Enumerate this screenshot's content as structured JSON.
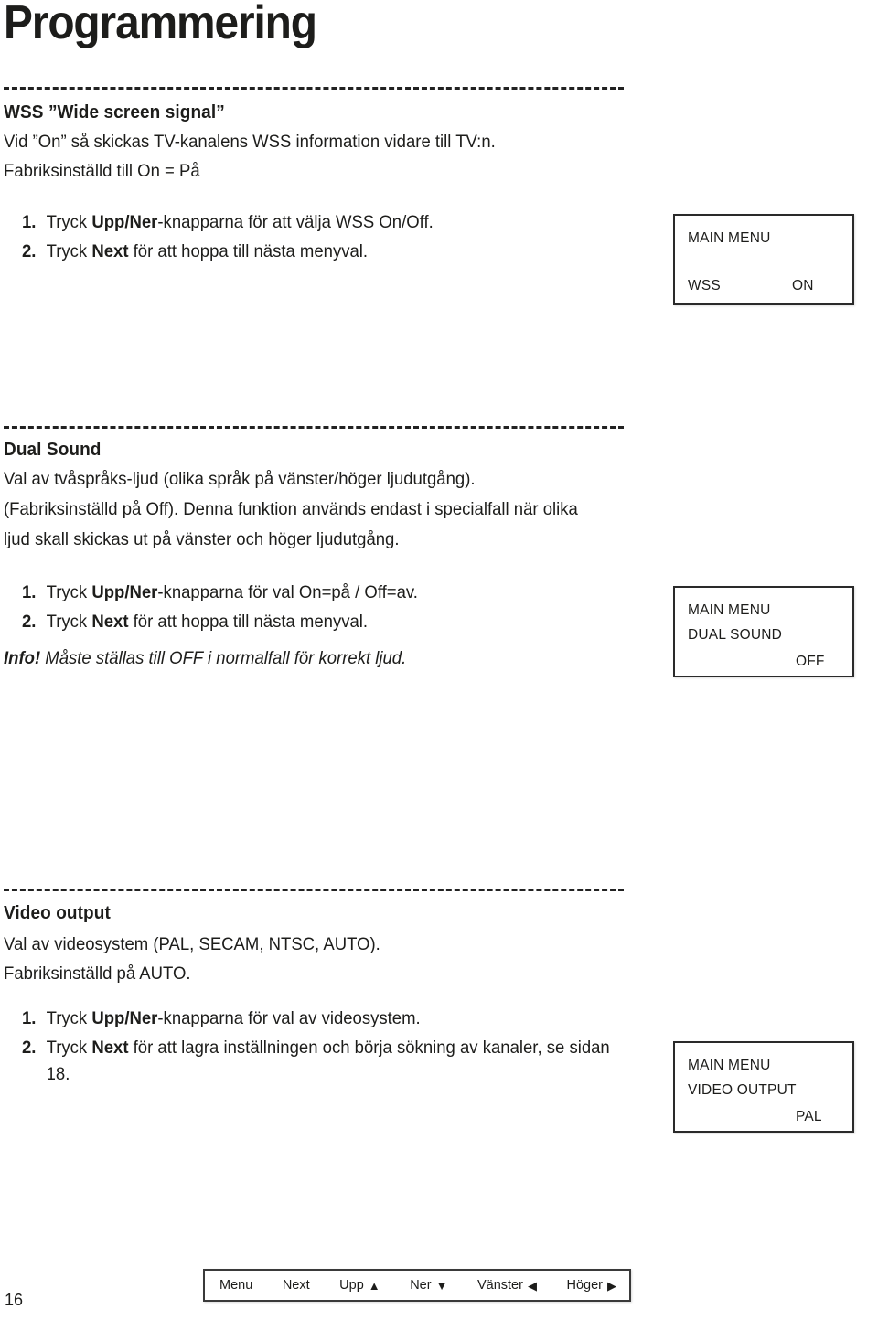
{
  "page": {
    "title": "Programmering",
    "number": "16"
  },
  "sections": [
    {
      "id": "wss",
      "heading": "WSS ”Wide screen signal”",
      "paragraphs": [
        "Vid ”On” så skickas TV-kanalens WSS information vidare till TV:n.",
        "Fabriksinställd till On = På"
      ],
      "steps": [
        {
          "num": "1.",
          "pre": "Tryck ",
          "bold": "Upp/Ner",
          "post": "-knapparna för att välja WSS On/Off."
        },
        {
          "num": "2.",
          "pre": "Tryck ",
          "bold": "Next",
          "post": " för att hoppa till nästa menyval."
        }
      ],
      "menu_box": {
        "title": "MAIN MENU",
        "item": "WSS",
        "value": "ON"
      }
    },
    {
      "id": "dual_sound",
      "heading": "Dual Sound",
      "paragraphs": [
        "Val av tvåspråks-ljud (olika språk på vänster/höger ljudutgång).",
        "(Fabriksinställd på Off). Denna funktion används endast i specialfall när olika",
        "ljud skall skickas ut på vänster och höger ljudutgång."
      ],
      "steps": [
        {
          "num": "1.",
          "pre": "Tryck ",
          "bold": "Upp/Ner",
          "post": "-knapparna för val On=på / Off=av."
        },
        {
          "num": "2.",
          "pre": "Tryck ",
          "bold": "Next",
          "post": " för att hoppa till nästa menyval."
        }
      ],
      "info": {
        "label": "Info!",
        "text": " Måste ställas till OFF i normalfall för korrekt ljud."
      },
      "menu_box": {
        "title": "MAIN MENU",
        "item": "DUAL SOUND",
        "value": "OFF"
      }
    },
    {
      "id": "video_output",
      "heading": "Video output",
      "paragraphs": [
        "Val av videosystem (PAL, SECAM, NTSC, AUTO).",
        "Fabriksinställd på AUTO."
      ],
      "steps": [
        {
          "num": "1.",
          "pre": "Tryck ",
          "bold": "Upp/Ner",
          "post": "-knapparna för val av videosystem."
        },
        {
          "num": "2.",
          "pre": "Tryck ",
          "bold": "Next",
          "post": " för att lagra inställningen och börja sökning av kanaler, se sidan 18."
        }
      ],
      "menu_box": {
        "title": "MAIN MENU",
        "item": "VIDEO OUTPUT",
        "value": "PAL"
      }
    }
  ],
  "nav_legend": {
    "items": [
      {
        "label": "Menu",
        "arrow": "",
        "arrow_icon": "none"
      },
      {
        "label": "Next",
        "arrow": "",
        "arrow_icon": "none"
      },
      {
        "label": "Upp",
        "arrow": "▲",
        "arrow_icon": "triangle-up-icon"
      },
      {
        "label": "Ner",
        "arrow": "▼",
        "arrow_icon": "triangle-down-icon"
      },
      {
        "label": "Vänster",
        "arrow": "◀",
        "arrow_icon": "triangle-left-icon"
      },
      {
        "label": "Höger",
        "arrow": "▶",
        "arrow_icon": "triangle-right-icon"
      }
    ]
  },
  "colors": {
    "text": "#1d1d1b",
    "rule": "#222222",
    "box_border": "#2a2a2a",
    "background": "#ffffff"
  }
}
